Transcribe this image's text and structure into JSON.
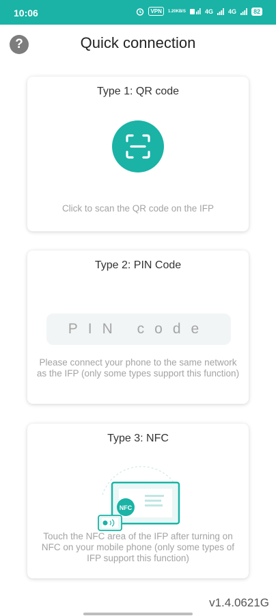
{
  "status_bar": {
    "time": "10:06",
    "vpn": "VPN",
    "speed_top": "1.20",
    "speed_bottom": "KB/S",
    "network_1": "4G",
    "network_2": "4G",
    "battery": "82"
  },
  "header": {
    "title": "Quick connection",
    "help_icon": "?"
  },
  "cards": {
    "qr": {
      "title": "Type 1: QR code",
      "icon": "qr-scan-icon",
      "description": "Click to scan the QR code on the IFP"
    },
    "pin": {
      "title": "Type 2: PIN Code",
      "placeholder": "PIN code",
      "description": "Please connect your phone to the same network as the IFP (only some types support this function)"
    },
    "nfc": {
      "title": "Type 3: NFC",
      "illustration_label": "NFC",
      "description": "Touch the NFC area of the IFP after turning on NFC on your mobile phone (only some types of IFP support this function)"
    }
  },
  "footer": {
    "version": "v1.4.0621G"
  },
  "colors": {
    "accent": "#1ab3a6",
    "text_muted": "#a3a3a3"
  }
}
